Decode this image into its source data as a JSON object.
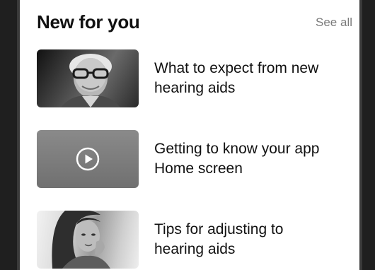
{
  "section": {
    "title": "New for you",
    "see_all_label": "See all"
  },
  "articles": [
    {
      "title_line1": "What to expect from new",
      "title_line2": "hearing aids",
      "thumbnail_icon": "photo-man-with-glasses"
    },
    {
      "title_line1": "Getting to know your app",
      "title_line2": "Home screen",
      "thumbnail_icon": "play-icon"
    },
    {
      "title_line1": "Tips for adjusting to",
      "title_line2": "hearing aids",
      "thumbnail_icon": "photo-woman-touching-ear"
    }
  ],
  "colors": {
    "title_text": "#111111",
    "see_all_text": "#7a7a7a",
    "background": "#ffffff",
    "bezel": "#1f1f1f"
  }
}
